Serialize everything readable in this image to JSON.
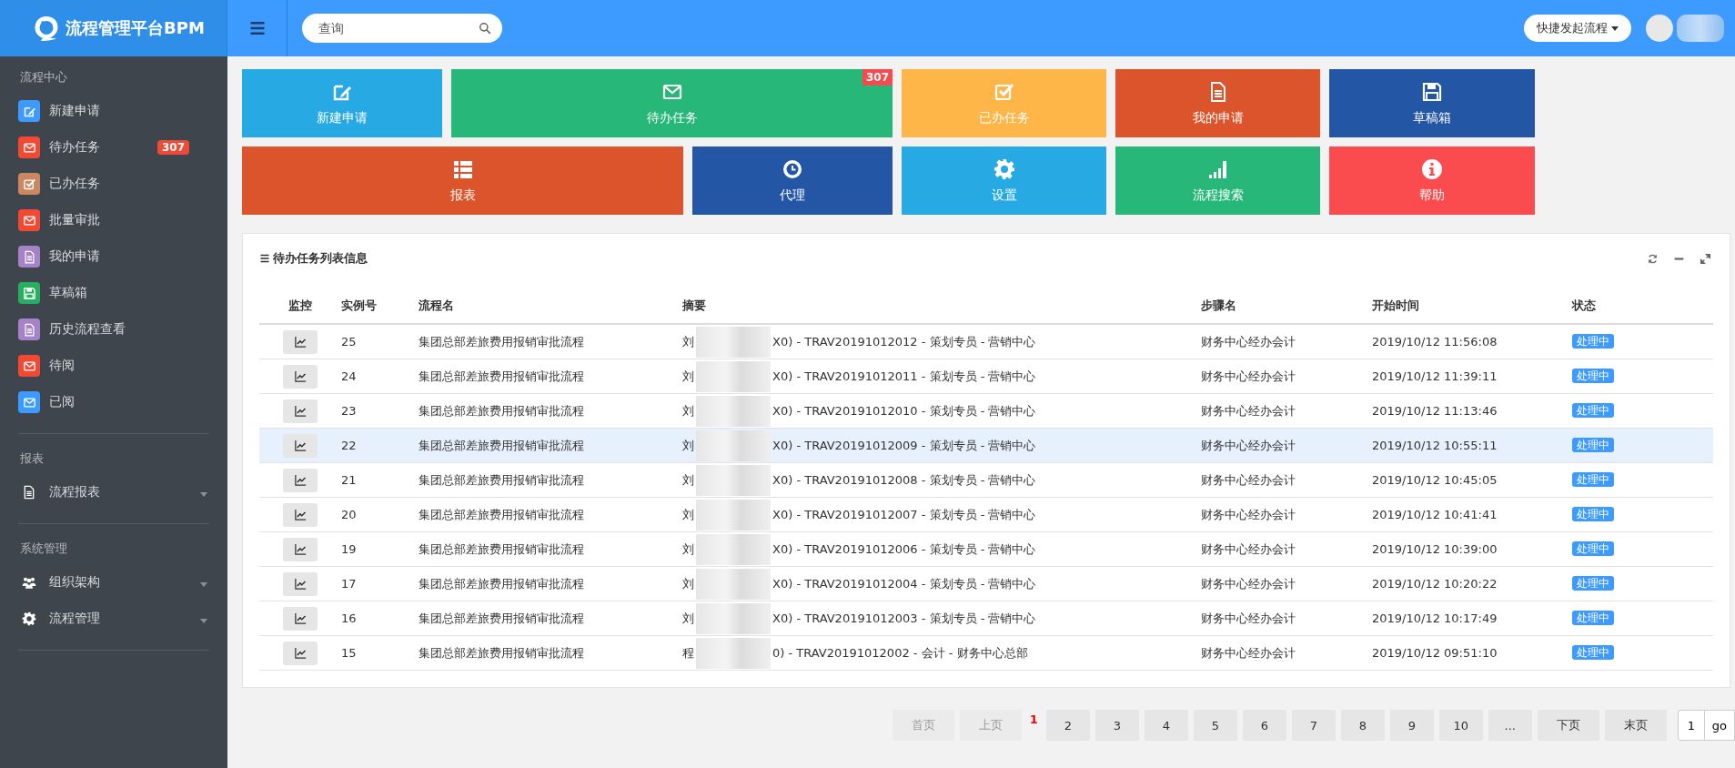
{
  "header": {
    "logo_text": "流程管理平台BPM",
    "search": {
      "placeholder": "查询"
    },
    "quick_button": "快捷发起流程"
  },
  "sidebar": {
    "sections": [
      {
        "title": "流程中心",
        "items": [
          {
            "label": "新建申请",
            "color": "#3d9bff"
          },
          {
            "label": "待办任务",
            "color": "#f04a34",
            "badge": "307"
          },
          {
            "label": "已办任务",
            "color": "#c98762"
          },
          {
            "label": "批量审批",
            "color": "#f04a34"
          },
          {
            "label": "我的申请",
            "color": "#a583c6"
          },
          {
            "label": "草稿箱",
            "color": "#27ae60"
          },
          {
            "label": "历史流程查看",
            "color": "#a583c6"
          },
          {
            "label": "待阅",
            "color": "#f04a34"
          },
          {
            "label": "已阅",
            "color": "#3d9bff"
          }
        ]
      },
      {
        "title": "报表",
        "items": [
          {
            "label": "流程报表",
            "expanded": false
          }
        ]
      },
      {
        "title": "系统管理",
        "items": [
          {
            "label": "组织架构",
            "expanded": false
          },
          {
            "label": "流程管理",
            "expanded": false
          }
        ]
      }
    ]
  },
  "tiles": [
    [
      {
        "label": "新建申请",
        "color": "#27aae3"
      },
      {
        "label": "待办任务",
        "color": "#27b879",
        "badge": "307"
      },
      {
        "label": "已办任务",
        "color": "#ffb648"
      },
      {
        "label": "我的申请",
        "color": "#dc542c"
      },
      {
        "label": "草稿箱",
        "color": "#2356a5"
      }
    ],
    [
      {
        "label": "报表",
        "color": "#dc542c"
      },
      {
        "label": "代理",
        "color": "#2356a5"
      },
      {
        "label": "设置",
        "color": "#27aae3"
      },
      {
        "label": "流程搜索",
        "color": "#27b879"
      },
      {
        "label": "帮助",
        "color": "#fa4b4f"
      }
    ]
  ],
  "panel": {
    "title": "待办任务列表信息",
    "table": {
      "columns": [
        "监控",
        "实例号",
        "流程名",
        "摘要",
        "步骤名",
        "开始时间",
        "状态"
      ],
      "rows": [
        {
          "instance": "25",
          "process": "集团总部差旅费用报销审批流程",
          "summary_lead": "刘",
          "summary_rest": "X0) - TRAV20191012012 - 策划专员 - 营销中心",
          "step": "财务中心经办会计",
          "start_time": "2019/10/12 11:56:08",
          "status": "处理中",
          "highlighted": false
        },
        {
          "instance": "24",
          "process": "集团总部差旅费用报销审批流程",
          "summary_lead": "刘",
          "summary_rest": "X0) - TRAV20191012011 - 策划专员 - 营销中心",
          "step": "财务中心经办会计",
          "start_time": "2019/10/12 11:39:11",
          "status": "处理中",
          "highlighted": false
        },
        {
          "instance": "23",
          "process": "集团总部差旅费用报销审批流程",
          "summary_lead": "刘",
          "summary_rest": "X0) - TRAV20191012010 - 策划专员 - 营销中心",
          "step": "财务中心经办会计",
          "start_time": "2019/10/12 11:13:46",
          "status": "处理中",
          "highlighted": false
        },
        {
          "instance": "22",
          "process": "集团总部差旅费用报销审批流程",
          "summary_lead": "刘",
          "summary_rest": "X0) - TRAV20191012009 - 策划专员 - 营销中心",
          "step": "财务中心经办会计",
          "start_time": "2019/10/12 10:55:11",
          "status": "处理中",
          "highlighted": true
        },
        {
          "instance": "21",
          "process": "集团总部差旅费用报销审批流程",
          "summary_lead": "刘",
          "summary_rest": "X0) - TRAV20191012008 - 策划专员 - 营销中心",
          "step": "财务中心经办会计",
          "start_time": "2019/10/12 10:45:05",
          "status": "处理中",
          "highlighted": false
        },
        {
          "instance": "20",
          "process": "集团总部差旅费用报销审批流程",
          "summary_lead": "刘",
          "summary_rest": "X0) - TRAV20191012007 - 策划专员 - 营销中心",
          "step": "财务中心经办会计",
          "start_time": "2019/10/12 10:41:41",
          "status": "处理中",
          "highlighted": false
        },
        {
          "instance": "19",
          "process": "集团总部差旅费用报销审批流程",
          "summary_lead": "刘",
          "summary_rest": "X0) - TRAV20191012006 - 策划专员 - 营销中心",
          "step": "财务中心经办会计",
          "start_time": "2019/10/12 10:39:00",
          "status": "处理中",
          "highlighted": false
        },
        {
          "instance": "17",
          "process": "集团总部差旅费用报销审批流程",
          "summary_lead": "刘",
          "summary_rest": "X0) - TRAV20191012004 - 策划专员 - 营销中心",
          "step": "财务中心经办会计",
          "start_time": "2019/10/12 10:20:22",
          "status": "处理中",
          "highlighted": false
        },
        {
          "instance": "16",
          "process": "集团总部差旅费用报销审批流程",
          "summary_lead": "刘",
          "summary_rest": "X0) - TRAV20191012003 - 策划专员 - 营销中心",
          "step": "财务中心经办会计",
          "start_time": "2019/10/12 10:17:49",
          "status": "处理中",
          "highlighted": false
        },
        {
          "instance": "15",
          "process": "集团总部差旅费用报销审批流程",
          "summary_lead": "程",
          "summary_rest": "0) - TRAV20191012002 - 会计 - 财务中心总部",
          "step": "财务中心经办会计",
          "start_time": "2019/10/12 09:51:10",
          "status": "处理中",
          "highlighted": false
        }
      ]
    }
  },
  "pagination": {
    "items": [
      {
        "label": "首页",
        "kind": "nav",
        "disabled": true
      },
      {
        "label": "上页",
        "kind": "nav",
        "disabled": true
      },
      {
        "label": "1",
        "kind": "page",
        "selected": true
      },
      {
        "label": "2",
        "kind": "page",
        "selected": false
      },
      {
        "label": "3",
        "kind": "page",
        "selected": false
      },
      {
        "label": "4",
        "kind": "page",
        "selected": false
      },
      {
        "label": "5",
        "kind": "page",
        "selected": false
      },
      {
        "label": "6",
        "kind": "page",
        "selected": false
      },
      {
        "label": "7",
        "kind": "page",
        "selected": false
      },
      {
        "label": "8",
        "kind": "page",
        "selected": false
      },
      {
        "label": "9",
        "kind": "page",
        "selected": false
      },
      {
        "label": "10",
        "kind": "page",
        "selected": false
      },
      {
        "label": "...",
        "kind": "gap"
      },
      {
        "label": "下页",
        "kind": "nav",
        "disabled": false
      },
      {
        "label": "末页",
        "kind": "nav",
        "disabled": false
      }
    ],
    "jump": {
      "value": "1",
      "button": "go"
    }
  }
}
